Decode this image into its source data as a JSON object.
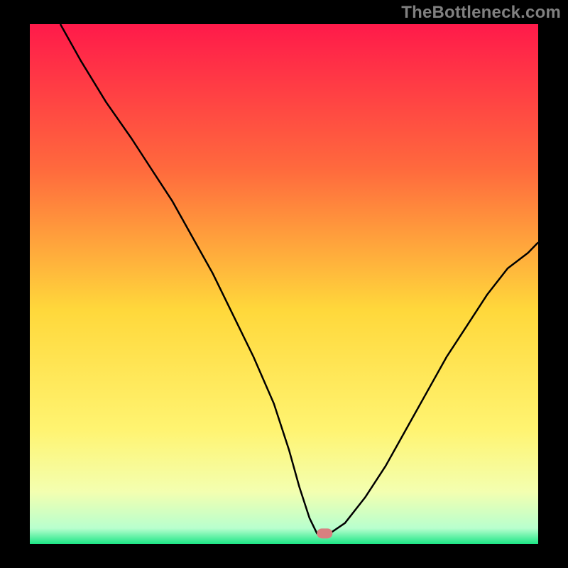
{
  "watermark": {
    "text": "TheBottleneck.com"
  },
  "palette": {
    "frame": "#000000",
    "curve": "#000000",
    "marker": "#d88080",
    "gradient_top": "#ff1a4a",
    "gradient_mid1": "#ff893a",
    "gradient_mid2": "#ffd83b",
    "gradient_mid3": "#fff471",
    "gradient_mid4": "#f3ffb0",
    "gradient_bottom": "#1de686"
  },
  "chart_data": {
    "type": "line",
    "title": "",
    "xlabel": "",
    "ylabel": "",
    "xlim": [
      0,
      100
    ],
    "ylim": [
      0,
      100
    ],
    "series": [
      {
        "name": "bottleneck-curve",
        "x": [
          6,
          10,
          15,
          20,
          24,
          28,
          32,
          36,
          40,
          44,
          48,
          51,
          53,
          55,
          56.5,
          59,
          62,
          66,
          70,
          74,
          78,
          82,
          86,
          90,
          94,
          98,
          100
        ],
        "y": [
          100,
          93,
          85,
          78,
          72,
          66,
          59,
          52,
          44,
          36,
          27,
          18,
          11,
          5,
          2,
          2,
          4,
          9,
          15,
          22,
          29,
          36,
          42,
          48,
          53,
          56,
          58
        ]
      }
    ],
    "flat_minimum": {
      "x_start": 55,
      "x_end": 59,
      "y": 2
    },
    "marker": {
      "x": 58,
      "y": 2,
      "shape": "rounded-rect"
    },
    "grid": false,
    "legend": false
  }
}
